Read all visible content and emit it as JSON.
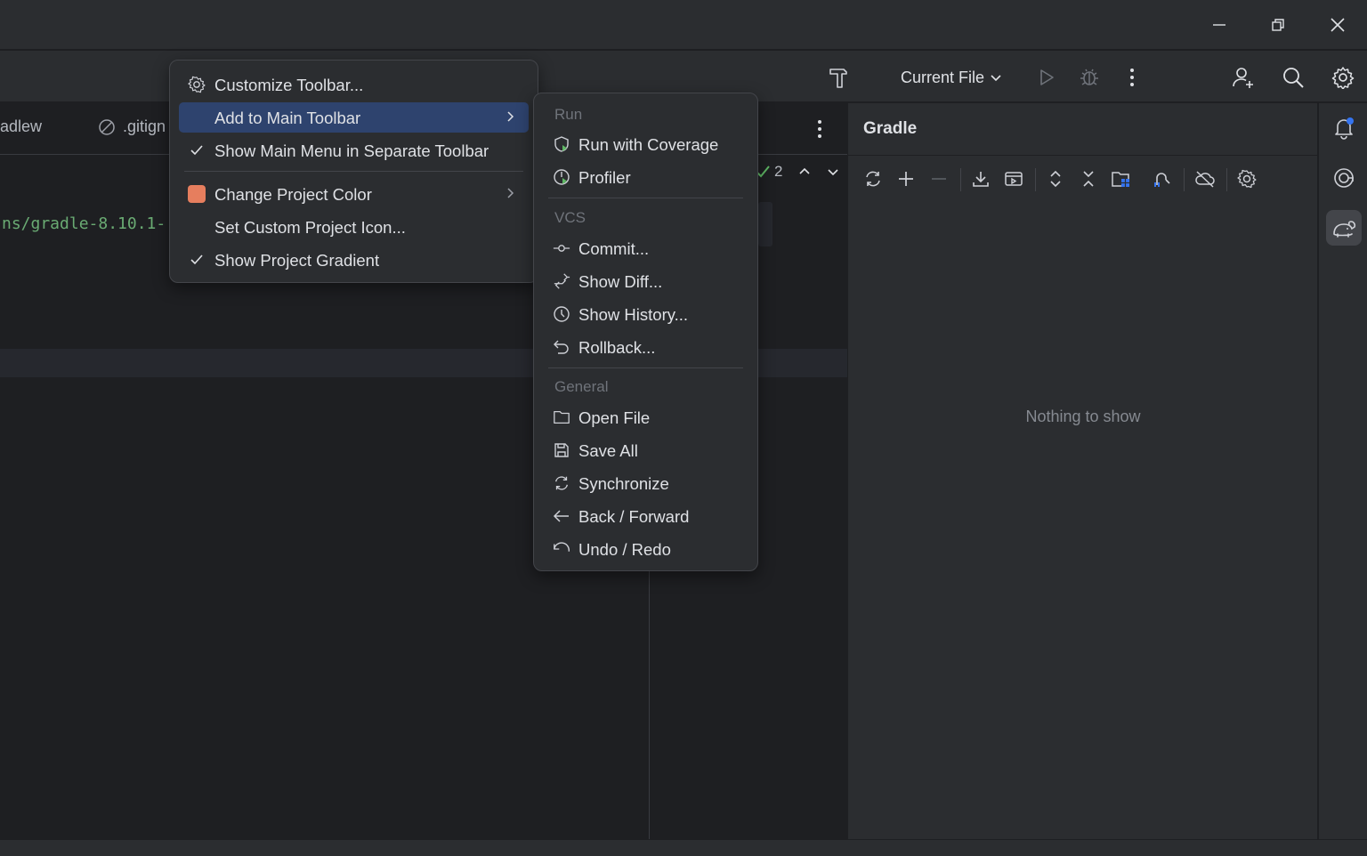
{
  "window": {
    "controls": [
      "minimize-icon",
      "restore-icon",
      "close-icon"
    ]
  },
  "toolbar": {
    "run_config_label": "Current File",
    "icons": [
      "build-hammer-icon",
      "run-icon",
      "debug-icon",
      "more-vertical-icon",
      "add-user-icon",
      "search-icon",
      "settings-gear-icon"
    ]
  },
  "editor": {
    "tabs": [
      {
        "label": "adlew",
        "icon": "none"
      },
      {
        "label": ".gitign",
        "icon": "ignored-file-icon"
      }
    ],
    "code_line": "ns/gradle-8.10.1-",
    "inspection_count": "2"
  },
  "gradle": {
    "title": "Gradle",
    "empty_text": "Nothing to show",
    "toolbar_icons": [
      "reload-icon",
      "add-icon",
      "remove-icon",
      "download-sources-icon",
      "run-task-icon",
      "expand-all-icon",
      "collapse-all-icon",
      "open-settings-file-icon",
      "dependency-analyzer-icon",
      "offline-mode-icon",
      "gradle-settings-icon"
    ]
  },
  "right_strip": {
    "icons": [
      "notifications-bell-icon",
      "ai-assistant-icon",
      "gradle-elephant-icon"
    ]
  },
  "context_menu": {
    "items": [
      {
        "label": "Customize Toolbar...",
        "icon": "gear-icon"
      },
      {
        "label": "Add to Main Toolbar",
        "submenu": true
      },
      {
        "label": "Show Main Menu in Separate Toolbar",
        "checked": true
      },
      {
        "label": "Change Project Color",
        "submenu": true,
        "swatch": "#e67e5e"
      },
      {
        "label": "Set Custom Project Icon..."
      },
      {
        "label": "Show Project Gradient",
        "checked": true
      }
    ]
  },
  "submenu": {
    "sections": [
      {
        "header": "Run",
        "items": [
          {
            "label": "Run with Coverage",
            "icon": "run-coverage-icon"
          },
          {
            "label": "Profiler",
            "icon": "profiler-icon"
          }
        ]
      },
      {
        "header": "VCS",
        "items": [
          {
            "label": "Commit...",
            "icon": "commit-icon"
          },
          {
            "label": "Show Diff...",
            "icon": "diff-icon"
          },
          {
            "label": "Show History...",
            "icon": "history-icon"
          },
          {
            "label": "Rollback...",
            "icon": "rollback-icon"
          }
        ]
      },
      {
        "header": "General",
        "items": [
          {
            "label": "Open File",
            "icon": "folder-icon"
          },
          {
            "label": "Save All",
            "icon": "save-icon"
          },
          {
            "label": "Synchronize",
            "icon": "synchronize-icon"
          },
          {
            "label": "Back / Forward",
            "icon": "back-arrow-icon"
          },
          {
            "label": "Undo / Redo",
            "icon": "undo-icon"
          }
        ]
      }
    ]
  },
  "colors": {
    "accent_selection": "#2e436e",
    "panel_bg": "#2b2d30",
    "editor_bg": "#1e1f22",
    "string_green": "#6aab73",
    "notification_dot": "#3574f0"
  }
}
